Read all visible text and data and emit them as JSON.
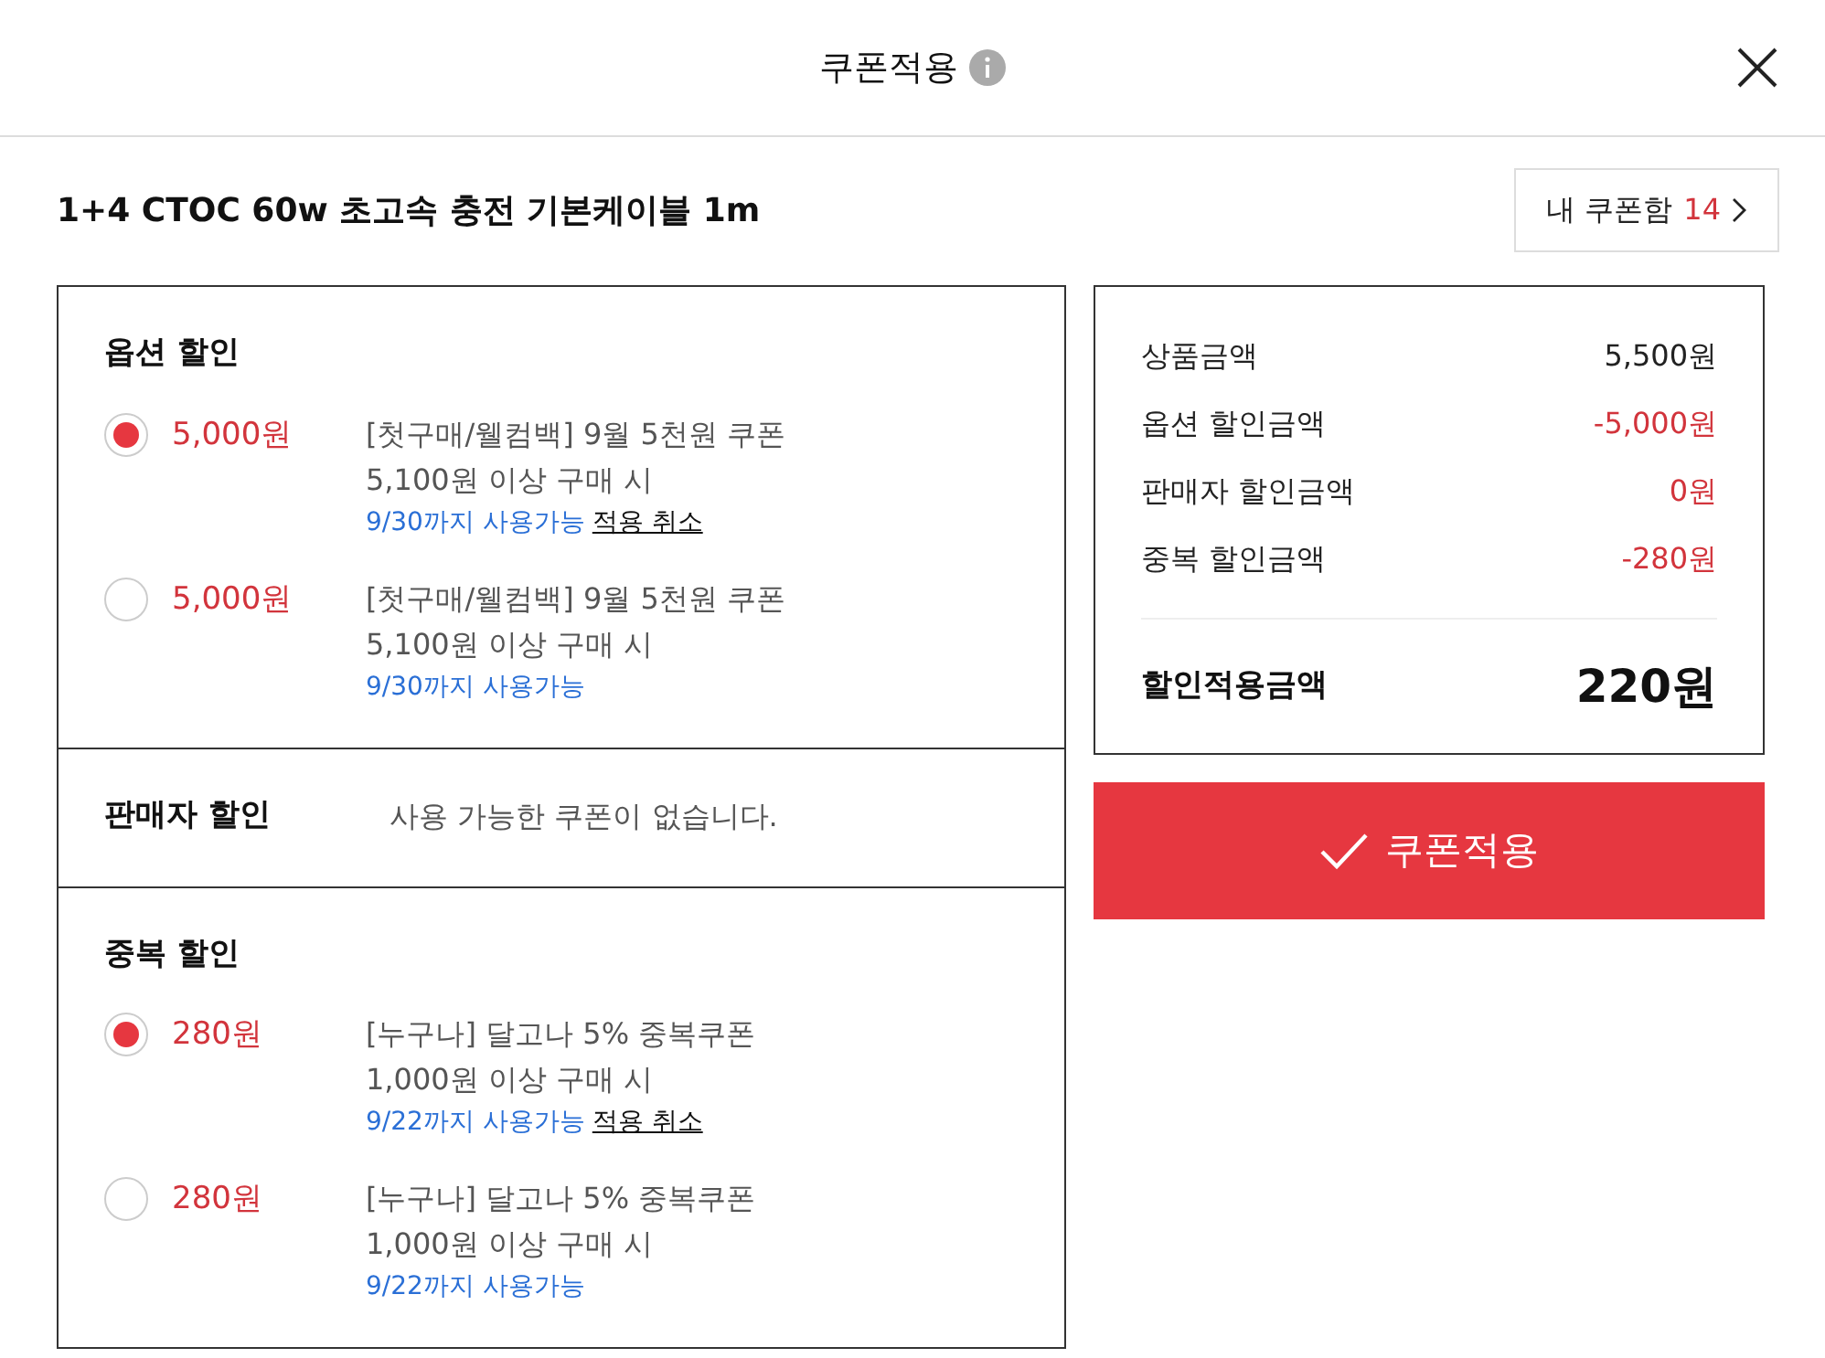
{
  "dialog": {
    "title": "쿠폰적용"
  },
  "product": {
    "name": "1+4 CTOC 60w 초고속 충전 기본케이블 1m"
  },
  "coupon_box": {
    "label": "내 쿠폰함",
    "count": "14"
  },
  "sections": [
    {
      "kind": "coupons",
      "title": "옵션 할인",
      "coupons": [
        {
          "amount": "5,000원",
          "name": "[첫구매/웰컴백] 9월 5천원 쿠폰",
          "condition": "5,100원 이상 구매 시",
          "expiry": "9/30까지 사용가능",
          "cancel": "적용 취소",
          "selected": true
        },
        {
          "amount": "5,000원",
          "name": "[첫구매/웰컴백] 9월 5천원 쿠폰",
          "condition": "5,100원 이상 구매 시",
          "expiry": "9/30까지 사용가능",
          "selected": false
        }
      ]
    },
    {
      "kind": "empty",
      "title": "판매자 할인",
      "message": "사용 가능한 쿠폰이 없습니다."
    },
    {
      "kind": "coupons",
      "title": "중복 할인",
      "coupons": [
        {
          "amount": "280원",
          "name": "[누구나] 달고나 5% 중복쿠폰",
          "condition": "1,000원 이상 구매 시",
          "expiry": "9/22까지 사용가능",
          "cancel": "적용 취소",
          "selected": true
        },
        {
          "amount": "280원",
          "name": "[누구나] 달고나 5% 중복쿠폰",
          "condition": "1,000원 이상 구매 시",
          "expiry": "9/22까지 사용가능",
          "selected": false
        }
      ]
    }
  ],
  "summary": {
    "rows": [
      {
        "kind": "base",
        "label": "상품금액",
        "value": "5,500원"
      },
      {
        "kind": "discount",
        "label": "옵션 할인금액",
        "value": "-5,000원"
      },
      {
        "kind": "discount",
        "label": "판매자 할인금액",
        "value": "0원"
      },
      {
        "kind": "discount",
        "label": "중복 할인금액",
        "value": "-280원"
      }
    ],
    "total_label": "할인적용금액",
    "total_value": "220원"
  },
  "apply_button": "쿠폰적용"
}
